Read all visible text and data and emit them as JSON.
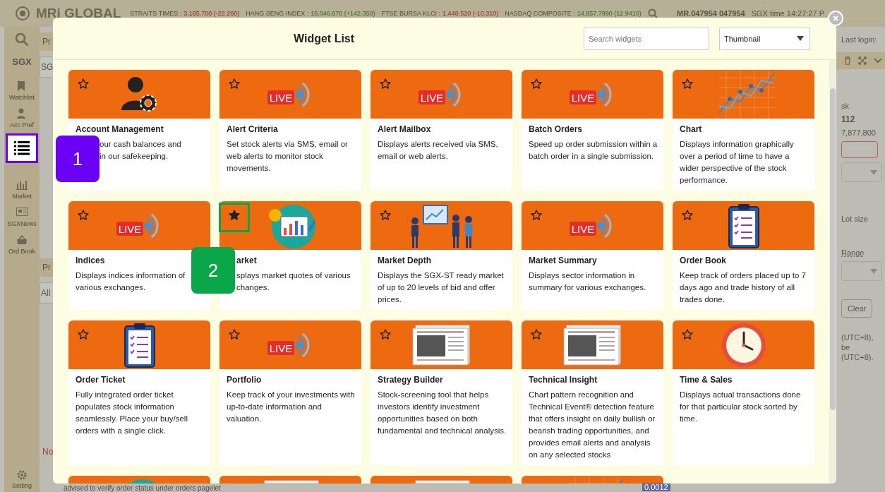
{
  "app": {
    "logo": "MRi GLOBAL",
    "tickers": [
      {
        "name": "STRAITS TIMES :",
        "value": "3,165.700",
        "change": "(-22.260)",
        "kind": "down"
      },
      {
        "name": "HANG SENG INDEX :",
        "value": "16,046.670",
        "change": "(+142.350)",
        "kind": "up"
      },
      {
        "name": "FTSE BURSA KLCI :",
        "value": "1,448.520",
        "change": "(-10.310)",
        "kind": "down"
      },
      {
        "name": "NASDAQ COMPOSITE :",
        "value": "14,857.7990",
        "change": "(12.9410)",
        "kind": "up"
      }
    ],
    "user": "MR.047954 047954",
    "time": "SGX time 14:27:27 P",
    "sidebar": {
      "exchange": "SGX",
      "items": [
        {
          "kind": "bookmark",
          "label": "Watchlist",
          "selected": false
        },
        {
          "kind": "person",
          "label": "Acc Pref",
          "selected": false
        },
        {
          "kind": "list",
          "selected": true
        },
        {
          "kind": "bars",
          "label": "Market",
          "selected": false
        },
        {
          "kind": "news",
          "label": "SGXNews",
          "selected": false
        },
        {
          "kind": "basket",
          "label": "Ord Book",
          "selected": false
        }
      ],
      "setting": "Setting"
    },
    "left_texts": {
      "tab": "Pr",
      "search": "SG",
      "section": "Pr",
      "filter": "All",
      "note": "No"
    },
    "right_panel": {
      "last_login": "Last login:",
      "column_1": "sk",
      "price": "112",
      "volume": "7,877,800",
      "lot_size": "Lot size",
      "range": "Range",
      "clear": "Clear",
      "note_lines": [
        "(UTC+8),",
        "be",
        "(UTC+8)."
      ]
    },
    "footer_note": "advised to verify order status under orders pagelet",
    "footer_value": "0.0012"
  },
  "modal": {
    "title": "Widget List",
    "search_placeholder": "Search widgets",
    "view_mode": "Thumbnail",
    "widgets": [
      {
        "kind": "person-gear",
        "title": "Account Management",
        "description": "our cash balances and\nin our safekeeping.",
        "favorite": false
      },
      {
        "kind": "live",
        "icon_text": "LIVE",
        "title": "Alert Criteria",
        "description": "Set stock alerts via SMS, email or web alerts to monitor stock movements.",
        "favorite": false
      },
      {
        "kind": "live",
        "icon_text": "LIVE",
        "title": "Alert Mailbox",
        "description": "Displays alerts received via SMS, email or web alerts.",
        "favorite": false
      },
      {
        "kind": "live",
        "icon_text": "LIVE",
        "title": "Batch Orders",
        "description": "Speed up order submission within a batch order in a single submission.",
        "favorite": false
      },
      {
        "kind": "line-chart",
        "title": "Chart",
        "description": "Displays information graphically over a period of time to have a wider perspective of the stock performance.",
        "favorite": false
      },
      {
        "kind": "live",
        "icon_text": "LIVE",
        "title": "Indices",
        "description": "Displays indices information of various exchanges.",
        "favorite": false
      },
      {
        "kind": "market",
        "title": "arket",
        "description": "splays market quotes of various\nchanges.",
        "favorite": true
      },
      {
        "kind": "presentation",
        "title": "Market Depth",
        "description": "Displays the SGX-ST ready market of up to 20 levels of bid and offer prices.",
        "favorite": false
      },
      {
        "kind": "live",
        "icon_text": "LIVE",
        "title": "Market Summary",
        "description": "Displays sector information in summary for various exchanges.",
        "favorite": false
      },
      {
        "kind": "clipboard",
        "title": "Order Book",
        "description": "Keep track of orders placed up to 7 days ago and trade history of all trades done.",
        "favorite": false
      },
      {
        "kind": "clipboard",
        "title": "Order Ticket",
        "description": "Fully integrated order ticket populates stock information seamlessly. Place your buy/sell orders with a single click.",
        "favorite": false
      },
      {
        "kind": "live",
        "icon_text": "LIVE",
        "title": "Portfolio",
        "description": "Keep track of your investments with up-to-date information and valuation.",
        "favorite": false
      },
      {
        "kind": "newspaper",
        "title": "Strategy Builder",
        "description": "Stock-screening tool that helps investors identify investment opportunities based on both fundamental and technical analysis.",
        "favorite": false
      },
      {
        "kind": "newspaper",
        "title": "Technical Insight",
        "description": "Chart pattern recognition and Technical Event® detection feature that offers insight on daily bullish or bearish trading opportunities, and provides email alerts and analysis on any selected stocks",
        "favorite": false
      },
      {
        "kind": "clock",
        "title": "Time & Sales",
        "description": "Displays actual transactions done for that particular stock sorted by time.",
        "favorite": false
      },
      {
        "kind": "market"
      },
      {
        "kind": "newspaper"
      },
      {
        "kind": "newspaper"
      },
      {
        "kind": "line-chart"
      }
    ]
  },
  "callouts": [
    {
      "label": "1",
      "color": "#6a00f4"
    },
    {
      "label": "2",
      "color": "#0aa64a"
    }
  ]
}
